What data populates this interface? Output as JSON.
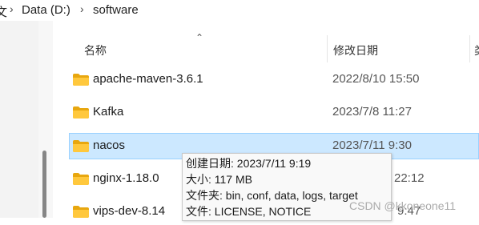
{
  "breadcrumb": {
    "clipped_start": "文",
    "drive": "Data (D:)",
    "folder": "software"
  },
  "columns": {
    "name": "名称",
    "modified": "修改日期",
    "clipped": "类"
  },
  "rows": [
    {
      "name": "apache-maven-3.6.1",
      "date": "2022/8/10 15:50"
    },
    {
      "name": "Kafka",
      "date": "2023/7/8 11:27"
    },
    {
      "name": "nacos",
      "date": "2023/7/11 9:30"
    },
    {
      "name": "nginx-1.18.0",
      "date": "22:12"
    },
    {
      "name": "vips-dev-8.14",
      "date": "9:47"
    }
  ],
  "tooltip": {
    "created": "创建日期: 2023/7/11 9:19",
    "size": "大小: 117 MB",
    "folders": "文件夹: bin, conf, data, logs, target",
    "files": "文件: LICENSE, NOTICE"
  },
  "watermark": "CSDN @kkoneone11",
  "colors": {
    "selected_bg": "#cce8ff",
    "selected_border": "#99d1ff",
    "folder": "#ffc83d"
  },
  "icons": [
    "chevron-right-icon",
    "sort-up-icon",
    "folder-icon"
  ]
}
